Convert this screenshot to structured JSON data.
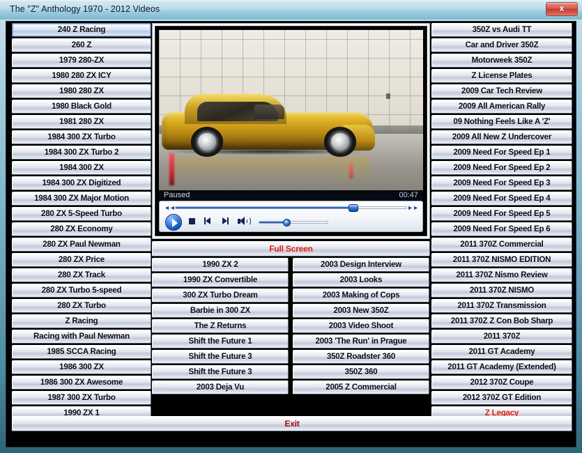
{
  "window": {
    "title": "The \"Z\" Anthology 1970 - 2012  Videos",
    "close_label": "x",
    "accent_red": "#e81c0c",
    "accent_darkred": "#9b0d12",
    "frame_color": "#7fb4c9"
  },
  "player": {
    "status": "Paused",
    "time": "00:47",
    "seek_percent": 77,
    "volume_percent": 40,
    "play_icon": "play-icon",
    "stop_icon": "stop-icon",
    "previous_icon": "previous-track-icon",
    "next_icon": "next-track-icon",
    "volume_icon": "volume-icon",
    "rewind_icon": "rewind-icon",
    "fastforward_icon": "fast-forward-icon"
  },
  "buttons": {
    "fullscreen": "Full Screen",
    "exit": "Exit"
  },
  "columns": {
    "left": [
      {
        "label": "240 Z Racing",
        "selected": true
      },
      {
        "label": "260 Z"
      },
      {
        "label": "1979 280-ZX"
      },
      {
        "label": "1980 280 ZX ICY"
      },
      {
        "label": "1980 280 ZX"
      },
      {
        "label": "1980 Black Gold"
      },
      {
        "label": "1981 280 ZX"
      },
      {
        "label": "1984 300 ZX Turbo"
      },
      {
        "label": "1984 300 ZX Turbo 2"
      },
      {
        "label": "1984 300 ZX"
      },
      {
        "label": "1984 300 ZX Digitized"
      },
      {
        "label": "1984 300 ZX Major Motion"
      },
      {
        "label": "280 ZX 5-Speed Turbo"
      },
      {
        "label": "280 ZX Economy"
      },
      {
        "label": "280 ZX Paul Newman"
      },
      {
        "label": "280 ZX Price"
      },
      {
        "label": "280 ZX Track"
      },
      {
        "label": "280 ZX Turbo 5-speed"
      },
      {
        "label": "280 ZX Turbo"
      },
      {
        "label": "Z Racing"
      },
      {
        "label": "Racing with Paul Newman"
      },
      {
        "label": "1985 SCCA Racing"
      },
      {
        "label": "1986 300 ZX"
      },
      {
        "label": "1986 300 ZX Awesome"
      },
      {
        "label": "1987 300 ZX Turbo"
      },
      {
        "label": "1990 ZX 1"
      }
    ],
    "middle_one": [
      {
        "label": "1990 ZX 2"
      },
      {
        "label": "1990 ZX Convertible"
      },
      {
        "label": "300 ZX Turbo Dream"
      },
      {
        "label": "Barbie in 300 ZX"
      },
      {
        "label": "The Z Returns"
      },
      {
        "label": "Shift the Future 1"
      },
      {
        "label": "Shift the Future 3"
      },
      {
        "label": "Shift the Future 3"
      },
      {
        "label": "2003 Deja Vu"
      }
    ],
    "middle_two": [
      {
        "label": "2003 Design Interview"
      },
      {
        "label": "2003 Looks"
      },
      {
        "label": "2003 Making of Cops"
      },
      {
        "label": "2003 New 350Z"
      },
      {
        "label": "2003 Video Shoot"
      },
      {
        "label": "2003  'The Run' in Prague"
      },
      {
        "label": "350Z Roadster 360"
      },
      {
        "label": "350Z 360"
      },
      {
        "label": "2005 Z Commercial"
      }
    ],
    "right": [
      {
        "label": "350Z vs Audi TT"
      },
      {
        "label": "Car and Driver 350Z"
      },
      {
        "label": "Motorweek 350Z"
      },
      {
        "label": "Z License Plates"
      },
      {
        "label": "2009 Car Tech Review"
      },
      {
        "label": "2009 All American Rally"
      },
      {
        "label": "09 Nothing Feels Like A 'Z'"
      },
      {
        "label": "2009 All New Z Undercover"
      },
      {
        "label": "2009  Need For Speed Ep 1"
      },
      {
        "label": "2009  Need For Speed Ep 2"
      },
      {
        "label": "2009  Need For Speed Ep 3"
      },
      {
        "label": "2009  Need For Speed Ep 4"
      },
      {
        "label": "2009  Need For Speed Ep 5"
      },
      {
        "label": "2009  Need For Speed Ep 6"
      },
      {
        "label": "2011 370Z Commercial"
      },
      {
        "label": "2011 370Z NISMO EDITION"
      },
      {
        "label": "2011 370Z Nismo Review"
      },
      {
        "label": "2011 370Z NISMO"
      },
      {
        "label": "2011 370Z Transmission"
      },
      {
        "label": "2011 370Z Z Con Bob Sharp"
      },
      {
        "label": "2011 370Z"
      },
      {
        "label": "2011 GT Academy"
      },
      {
        "label": "2011 GT Academy (Extended)"
      },
      {
        "label": "2012 370Z Coupe"
      },
      {
        "label": "2012 370Z GT Edition"
      },
      {
        "label": "Z Legacy",
        "style": "red"
      }
    ]
  }
}
